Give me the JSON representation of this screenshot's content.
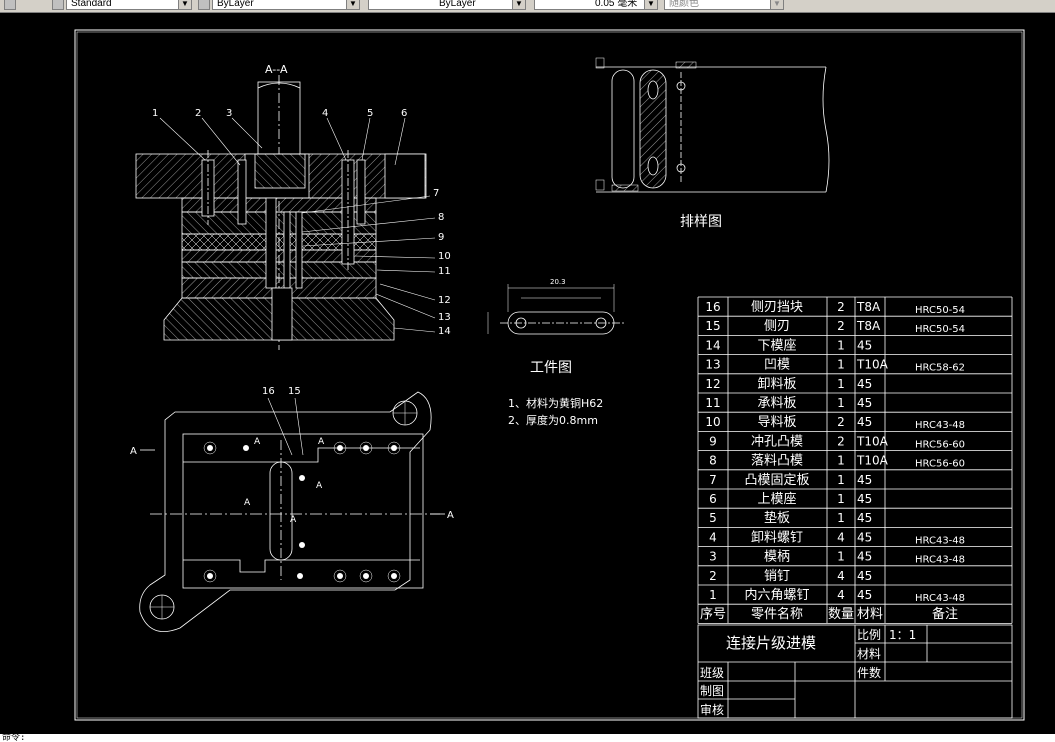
{
  "toolbar": {
    "textstyle": "Standard",
    "layer": "ByLayer",
    "linetype": "ByLayer",
    "lineweight": "0.05 毫米",
    "plotstyle": "随颜色"
  },
  "command_line": "命令:",
  "drawing": {
    "section_title": "A--A",
    "part_callouts": [
      "1",
      "2",
      "3",
      "4",
      "5",
      "6",
      "7",
      "8",
      "9",
      "10",
      "11",
      "12",
      "13",
      "14"
    ],
    "plan_callouts": [
      "16",
      "15"
    ],
    "section_marker": "A",
    "strip_layout_title": "排样图",
    "workpiece_title": "工件图",
    "workpiece_dim": "20.3",
    "notes": [
      "1、材料为黄铜H62",
      "2、厚度为0.8mm"
    ]
  },
  "bom": {
    "rows": [
      {
        "no": "16",
        "name": "侧刃挡块",
        "qty": "2",
        "mat": "T8A",
        "note": "HRC50-54"
      },
      {
        "no": "15",
        "name": "侧刃",
        "qty": "2",
        "mat": "T8A",
        "note": "HRC50-54"
      },
      {
        "no": "14",
        "name": "下模座",
        "qty": "1",
        "mat": "45",
        "note": ""
      },
      {
        "no": "13",
        "name": "凹模",
        "qty": "1",
        "mat": "T10A",
        "note": "HRC58-62"
      },
      {
        "no": "12",
        "name": "卸料板",
        "qty": "1",
        "mat": "45",
        "note": ""
      },
      {
        "no": "11",
        "name": "承料板",
        "qty": "1",
        "mat": "45",
        "note": ""
      },
      {
        "no": "10",
        "name": "导料板",
        "qty": "2",
        "mat": "45",
        "note": "HRC43-48"
      },
      {
        "no": "9",
        "name": "冲孔凸模",
        "qty": "2",
        "mat": "T10A",
        "note": "HRC56-60"
      },
      {
        "no": "8",
        "name": "落料凸模",
        "qty": "1",
        "mat": "T10A",
        "note": "HRC56-60"
      },
      {
        "no": "7",
        "name": "凸模固定板",
        "qty": "1",
        "mat": "45",
        "note": ""
      },
      {
        "no": "6",
        "name": "上模座",
        "qty": "1",
        "mat": "45",
        "note": ""
      },
      {
        "no": "5",
        "name": "垫板",
        "qty": "1",
        "mat": "45",
        "note": ""
      },
      {
        "no": "4",
        "name": "卸料螺钉",
        "qty": "4",
        "mat": "45",
        "note": "HRC43-48"
      },
      {
        "no": "3",
        "name": "模柄",
        "qty": "1",
        "mat": "45",
        "note": "HRC43-48"
      },
      {
        "no": "2",
        "name": "销钉",
        "qty": "4",
        "mat": "45",
        "note": ""
      },
      {
        "no": "1",
        "name": "内六角螺钉",
        "qty": "4",
        "mat": "45",
        "note": "HRC43-48"
      }
    ],
    "header": {
      "no": "序号",
      "name": "零件名称",
      "qty": "数量",
      "mat": "材料",
      "note": "备注"
    },
    "title_block": {
      "drawing_name": "连接片级进模",
      "scale_label": "比例",
      "scale_value": "1：1",
      "material_label": "材料",
      "count_label": "件数",
      "class_label": "班级",
      "drawn_label": "制图",
      "check_label": "审核"
    }
  }
}
